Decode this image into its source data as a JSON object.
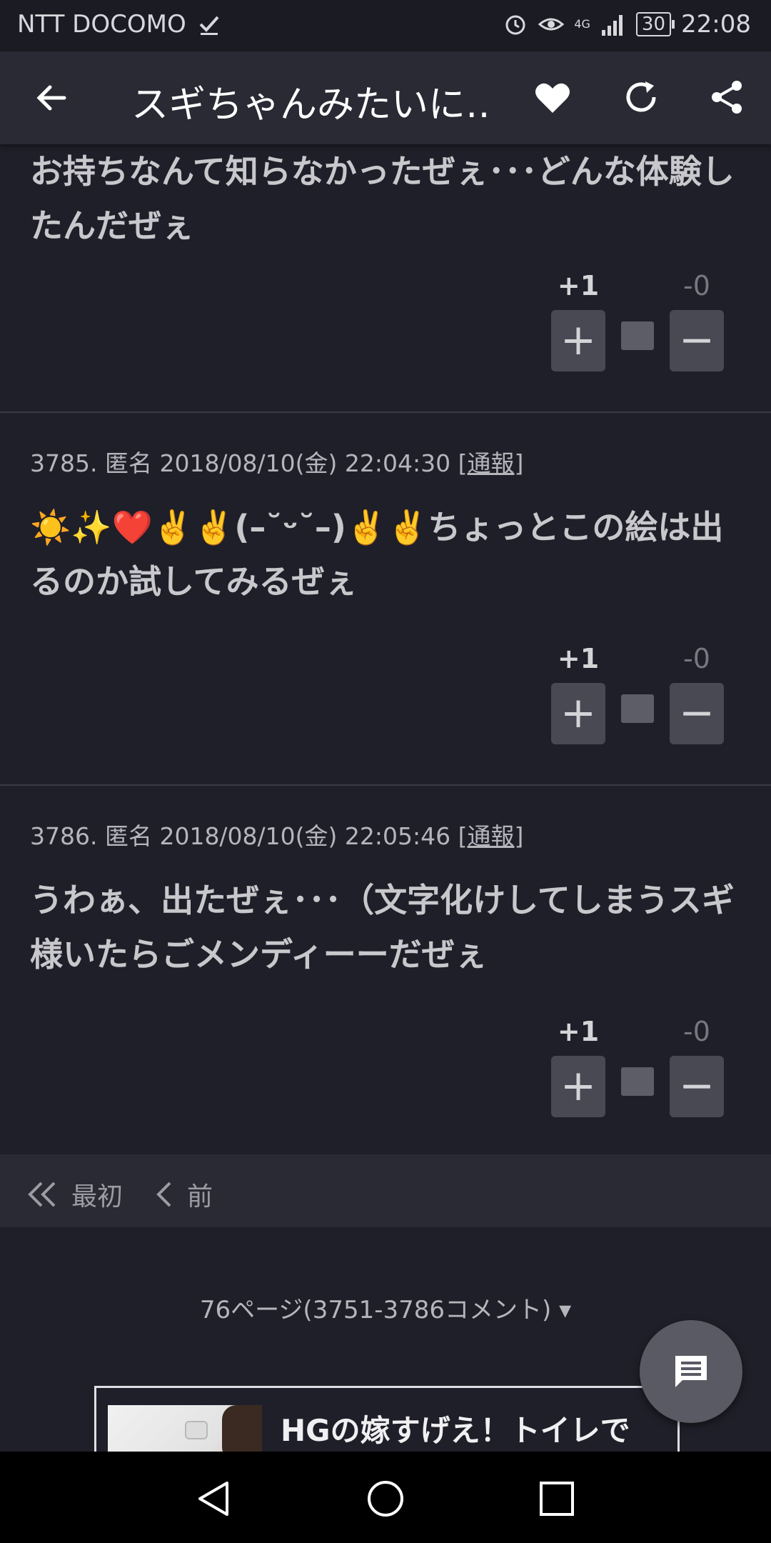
{
  "status_bar": {
    "carrier": "NTT DOCOMO",
    "network": "4G",
    "battery": "30",
    "time": "22:08"
  },
  "app_bar": {
    "title": "スギちゃんみたいに…"
  },
  "comments": [
    {
      "body": "お持ちなんて知らなかったぜぇ･･･どんな体験したんだぜぇ",
      "plus": "+1",
      "minus": "-0"
    },
    {
      "meta": "3785. 匿名 2018/08/10(金) 22:04:30",
      "report": "[通報]",
      "body": "☀️✨❤️✌️✌️(–˘ᵕ˘–)✌️✌️ちょっとこの絵は出るのか試してみるぜぇ",
      "plus": "+1",
      "minus": "-0"
    },
    {
      "meta": "3786. 匿名 2018/08/10(金) 22:05:46",
      "report": "[通報]",
      "body": "うわぁ、出たぜぇ･･･（文字化けしてしまうスギ様いたらごメンディーーだぜぇ",
      "plus": "+1",
      "minus": "-0"
    }
  ],
  "pager": {
    "first": "最初",
    "prev": "前"
  },
  "page_info": "76ページ(3751-3786コメント) ▾",
  "ad": {
    "headline": "HGの嫁すげえ！トイレで"
  },
  "colors": {
    "background": "#1f1f29",
    "app_bar": "#2a2a35",
    "vote_button": "#494954",
    "fab": "#5a5a64"
  }
}
